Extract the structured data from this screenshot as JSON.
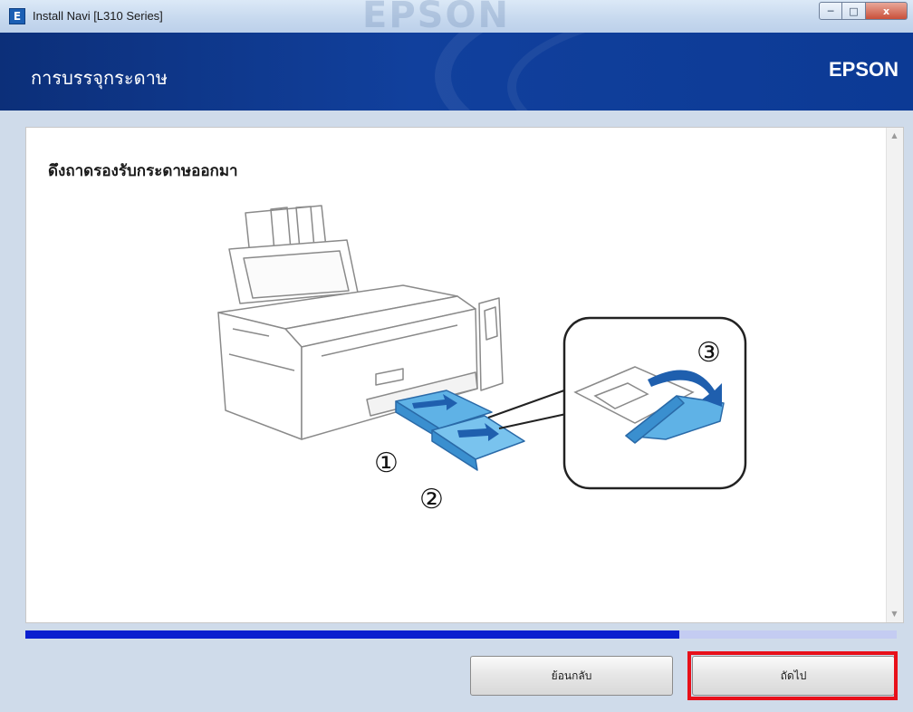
{
  "window": {
    "title": "Install Navi [L310 Series]",
    "app_icon_glyph": "E",
    "controls": {
      "minimize": "─",
      "maximize": "□",
      "close": "x"
    }
  },
  "header": {
    "page_title": "การบรรจุกระดาษ",
    "brand": "EPSON"
  },
  "content": {
    "instruction": "ดึงถาดรองรับกระดาษออกมา",
    "step_markers": [
      "①",
      "②",
      "③"
    ]
  },
  "progress": {
    "fraction": 0.75
  },
  "buttons": {
    "back_label": "ย้อนกลับ",
    "next_label": "ถัดไป"
  },
  "colors": {
    "header_bg": "#11409d",
    "progress_fill": "#0a1fcf",
    "progress_track": "#c4ccf2",
    "highlight": "#e8101a",
    "illustration_accent": "#3f9bd8"
  },
  "icons": [
    "app-icon",
    "minimize-icon",
    "maximize-icon",
    "close-icon",
    "scroll-up-icon",
    "scroll-down-icon"
  ]
}
